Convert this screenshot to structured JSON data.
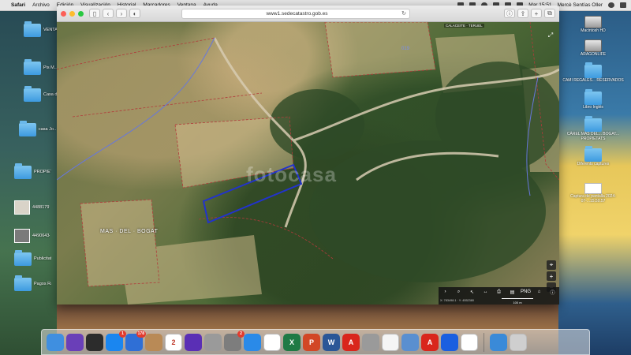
{
  "menubar": {
    "app_name": "Safari",
    "items": [
      "Archivo",
      "Edición",
      "Visualización",
      "Historial",
      "Marcadores",
      "Ventana",
      "Ayuda"
    ],
    "clock": "Mar 15:51",
    "user": "Mercè Sentías Oller"
  },
  "browser": {
    "url": "www1.sedecatastro.gob.es"
  },
  "map": {
    "watermark": "fotocasa",
    "place_label": "MAS · DEL · BOGAT",
    "zone_label": "019",
    "corner_label": "CALACEITE · TERUEL",
    "coords": "X: 783498.1 · Y: 4552380",
    "scale": "100 m",
    "toolbar_icons": [
      "chevron-right-icon",
      "search-icon",
      "pointer-icon",
      "measure-icon",
      "square-icon",
      "print-icon",
      "layers-icon",
      "png-label",
      "route-icon",
      "bike-icon",
      "info-icon"
    ]
  },
  "desktop_left": [
    {
      "label": "VENTA",
      "kind": "folder"
    },
    {
      "label": "Pis M... Maig...",
      "kind": "folder"
    },
    {
      "label": "Casa d... 23",
      "kind": "folder"
    },
    {
      "label": "casa Jo... Massali...",
      "kind": "folder"
    },
    {
      "label": "PROPIETA... FER",
      "kind": "folder"
    },
    {
      "label": "448817976_452... 0084193...496_n",
      "kind": "thumb"
    },
    {
      "label": "449064344_86... 16912714..._772_n",
      "kind": "thumb-dark"
    },
    {
      "label": "Publicitat c...",
      "kind": "folder"
    },
    {
      "label": "Pagos Rami...",
      "kind": "folder"
    }
  ],
  "desktop_right": [
    {
      "label": "Macintosh HD",
      "kind": "drive"
    },
    {
      "label": "ARAGONLIFE",
      "kind": "drive"
    },
    {
      "label": "CAMI REGALES... RESERVADOS",
      "kind": "folder"
    },
    {
      "label": "Libro Inglés",
      "kind": "folder"
    },
    {
      "label": "CÀREL MAS DEL... BOGAT... PROPIETATS",
      "kind": "folder"
    },
    {
      "label": "Diferents captures",
      "kind": "folder"
    },
    {
      "label": "Captura de pantalla 2024-07-...15.50.57",
      "kind": "shot"
    }
  ],
  "dock": {
    "apps": [
      {
        "name": "finder-icon",
        "color": "#3f8fe0"
      },
      {
        "name": "siri-icon",
        "color": "#6a3fb8"
      },
      {
        "name": "mission-control-icon",
        "color": "#2c2c2c"
      },
      {
        "name": "app-store-icon",
        "color": "#1a86f0",
        "badge": "1"
      },
      {
        "name": "photo-app-icon",
        "color": "#2f6fd6",
        "badge": "178"
      },
      {
        "name": "contacts-icon",
        "color": "#b98a56"
      },
      {
        "name": "calendar-icon",
        "color": "#ffffff",
        "text": "2"
      },
      {
        "name": "imovie-icon",
        "color": "#5a2fb5"
      },
      {
        "name": "blocked-app-icon",
        "color": "#9a9a9a"
      },
      {
        "name": "system-preferences-icon",
        "color": "#7d7d7d",
        "badge": "2"
      },
      {
        "name": "safari-icon",
        "color": "#2a8ae8"
      },
      {
        "name": "photos-icon",
        "color": "#ffffff"
      },
      {
        "name": "excel-icon",
        "color": "#1f7a45",
        "text": "X"
      },
      {
        "name": "powerpoint-icon",
        "color": "#d24726",
        "text": "P"
      },
      {
        "name": "word-icon",
        "color": "#2b5797",
        "text": "W"
      },
      {
        "name": "acrobat-icon",
        "color": "#d9261c",
        "text": "A"
      },
      {
        "name": "blocked-app-2-icon",
        "color": "#9a9a9a"
      },
      {
        "name": "itunes-icon",
        "color": "#f5f5f5"
      },
      {
        "name": "preview-icon",
        "color": "#5a8fd0"
      },
      {
        "name": "acrobat-2-icon",
        "color": "#d9261c",
        "text": "A"
      },
      {
        "name": "teamviewer-icon",
        "color": "#1b5fe0"
      },
      {
        "name": "chrome-icon",
        "color": "#ffffff"
      },
      {
        "name": "downloads-icon",
        "color": "#3a8ad8"
      },
      {
        "name": "trash-icon",
        "color": "#cfcfcf"
      }
    ]
  },
  "colors": {
    "parcel_outline": "#2233cc",
    "cadastral_line": "#b23a3a",
    "road_line": "#6677dd"
  }
}
